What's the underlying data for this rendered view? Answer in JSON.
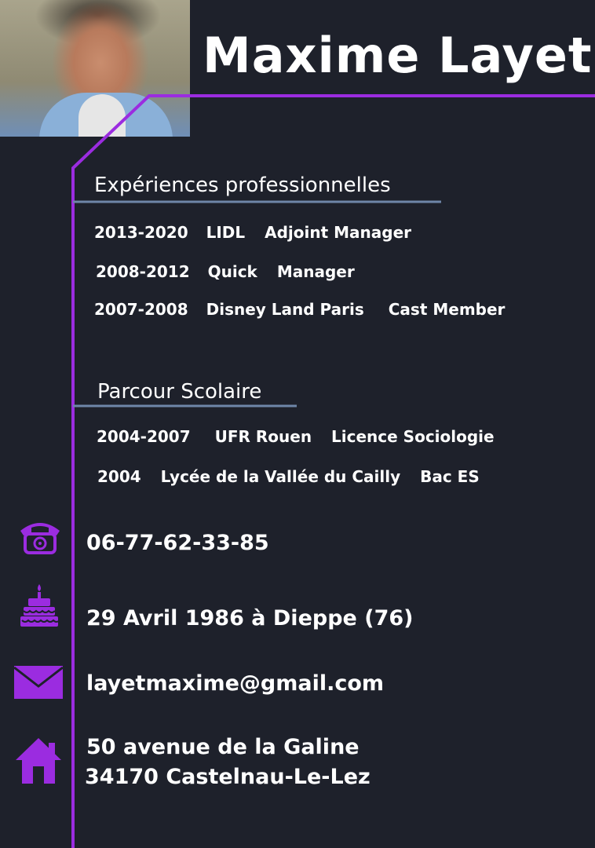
{
  "profile": {
    "name": "Maxime Layet"
  },
  "experience": {
    "title": "Expériences professionnelles",
    "items": [
      {
        "years": "2013-2020",
        "company": "LIDL",
        "role": "Adjoint Manager"
      },
      {
        "years": "2008-2012",
        "company": "Quick",
        "role": "Manager"
      },
      {
        "years": "2007-2008",
        "company": "Disney Land Paris",
        "role": "Cast Member"
      }
    ]
  },
  "education": {
    "title": "Parcour Scolaire",
    "items": [
      {
        "years": "2004-2007",
        "school": "UFR Rouen",
        "degree": "Licence Sociologie"
      },
      {
        "years": "2004",
        "school": "Lycée de la Vallée du Cailly",
        "degree": "Bac ES"
      }
    ]
  },
  "contact": {
    "phone": "06-77-62-33-85",
    "birth": "29 Avril 1986 à Dieppe (76)",
    "email": "layetmaxime@gmail.com",
    "address_line1": "50 avenue de la Galine",
    "address_line2": "34170 Castelnau-Le-Lez",
    "icons": [
      "phone-icon",
      "birthday-cake-icon",
      "envelope-icon",
      "house-icon"
    ]
  },
  "colors": {
    "background": "#1e212b",
    "accent": "#9b2ce0",
    "underline": "#6e86a8",
    "text": "#ffffff"
  }
}
